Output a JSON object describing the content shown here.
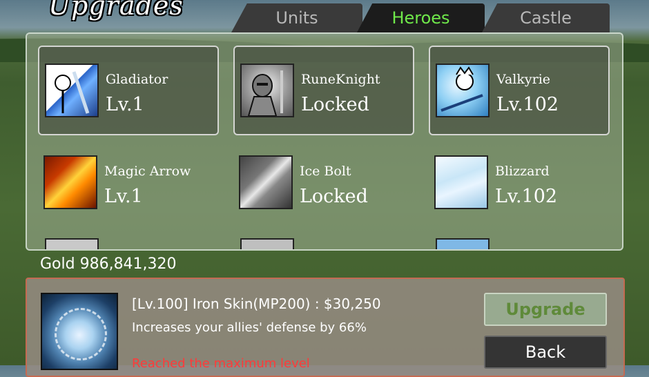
{
  "title": "Upgrades",
  "tabs": [
    {
      "label": "Units",
      "active": false
    },
    {
      "label": "Heroes",
      "active": true
    },
    {
      "label": "Castle",
      "active": false
    }
  ],
  "heroes": [
    {
      "name": "Gladiator",
      "level": "Lv.1",
      "icon": "gladiator-icon"
    },
    {
      "name": "RuneKnight",
      "level": "Locked",
      "icon": "rune-knight-icon"
    },
    {
      "name": "Valkyrie",
      "level": "Lv.102",
      "icon": "valkyrie-icon"
    }
  ],
  "skills": [
    {
      "name": "Magic Arrow",
      "level": "Lv.1",
      "icon": "magic-arrow-icon"
    },
    {
      "name": "Ice Bolt",
      "level": "Locked",
      "icon": "ice-bolt-icon"
    },
    {
      "name": "Blizzard",
      "level": "Lv.102",
      "icon": "blizzard-icon"
    }
  ],
  "gold": "Gold 986,841,320",
  "selected": {
    "icon": "iron-skin-icon",
    "line1": "[Lv.100] Iron Skin(MP200) : $30,250",
    "line2": "Increases your allies' defense by 66%",
    "line3": "Reached the maximum level"
  },
  "buttons": {
    "upgrade": "Upgrade",
    "back": "Back"
  },
  "colors": {
    "active_tab": "#6fe84a",
    "warning": "#ff3a3a",
    "info_border": "#c56a52"
  }
}
